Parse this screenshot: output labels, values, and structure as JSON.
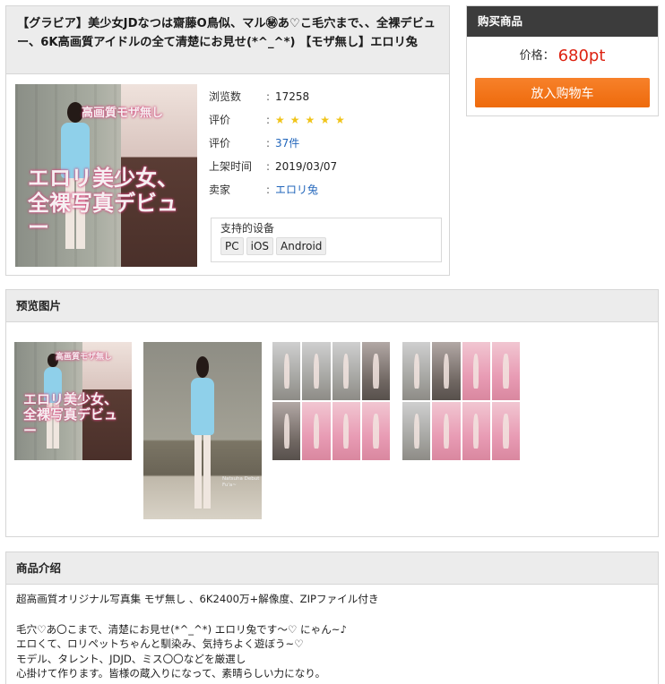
{
  "product": {
    "title": "【グラビア】美少女JDなつは齋藤O鳥似、マル㊙あ♡こ毛穴まで、、全裸デビュー、6K高画質アイドルの全て清楚にお見せ(*^_^*) 【モザ無し】エロリ兔",
    "cover_text": {
      "top": "高画質モザ無し",
      "main": "エロリ美少女、全裸写真デビュー"
    },
    "watermark": "eroli.co",
    "info": [
      {
        "label": "浏览数",
        "value": "17258"
      },
      {
        "label": "评价",
        "value": "★★★★★"
      },
      {
        "label": "评价",
        "value": "37件"
      },
      {
        "label": "上架时间",
        "value": "2019/03/07"
      },
      {
        "label": "卖家",
        "value": "エロリ兔"
      }
    ],
    "colon": ":",
    "devices_title": "支持的设备",
    "devices": [
      "PC",
      "iOS",
      "Android"
    ]
  },
  "buy": {
    "title": "购买商品",
    "price_label": "价格：",
    "price_value": "680pt",
    "button_label": "放入购物车"
  },
  "preview": {
    "title": "预览图片",
    "thumb1_text_top": "高画質モザ無し",
    "thumb1_text_main": "エロリ美少女、全裸写真デビュー",
    "thumb2_caption": "Natsuha Debut Fu'a~"
  },
  "intro": {
    "title": "商品介绍",
    "line1": "超高画質オリジナル写真集 モザ無し 、6K2400万+解像度、ZIPファイル付き",
    "line2": "毛穴♡あ〇こまで、清楚にお見せ(*^_^*) エロリ兔です～♡ にゃん~♪",
    "line3": "エロくて、ロリペットちゃんと馴染み、気持ちよく遊ぼう~♡",
    "line4": "モデル、タレント、JDJD、ミス〇〇などを厳選し",
    "line5": "心掛けて作ります。皆様の蔵入りになって、素晴らしい力になり。"
  },
  "colors": {
    "price": "#dd2211",
    "button": "#f07318",
    "buy_header": "#3c3c3c",
    "link": "#2266bb",
    "star": "#f0c419"
  }
}
